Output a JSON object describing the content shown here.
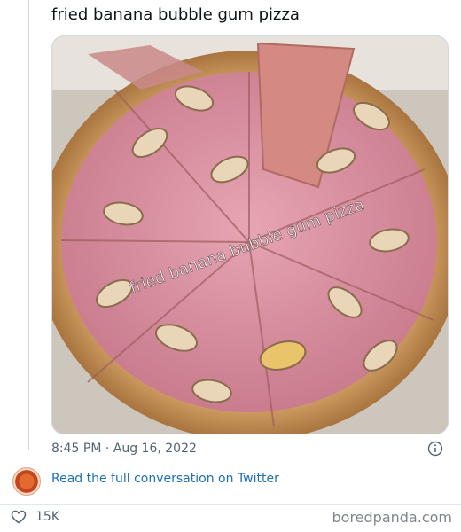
{
  "tweet": {
    "text": "fried banana bubble gum pizza",
    "image_caption": "fried banana bubble gum pizza",
    "timestamp": "8:45 PM · Aug 16, 2022"
  },
  "footer": {
    "read_link": "Read the full conversation on Twitter",
    "like_count": "15K",
    "source": "boredpanda.com"
  },
  "colors": {
    "link": "#1d6fb8",
    "muted": "#536471",
    "like": "#536471"
  },
  "icons": {
    "info": "info-icon",
    "like": "heart-icon",
    "avatar": "pizza-avatar"
  }
}
